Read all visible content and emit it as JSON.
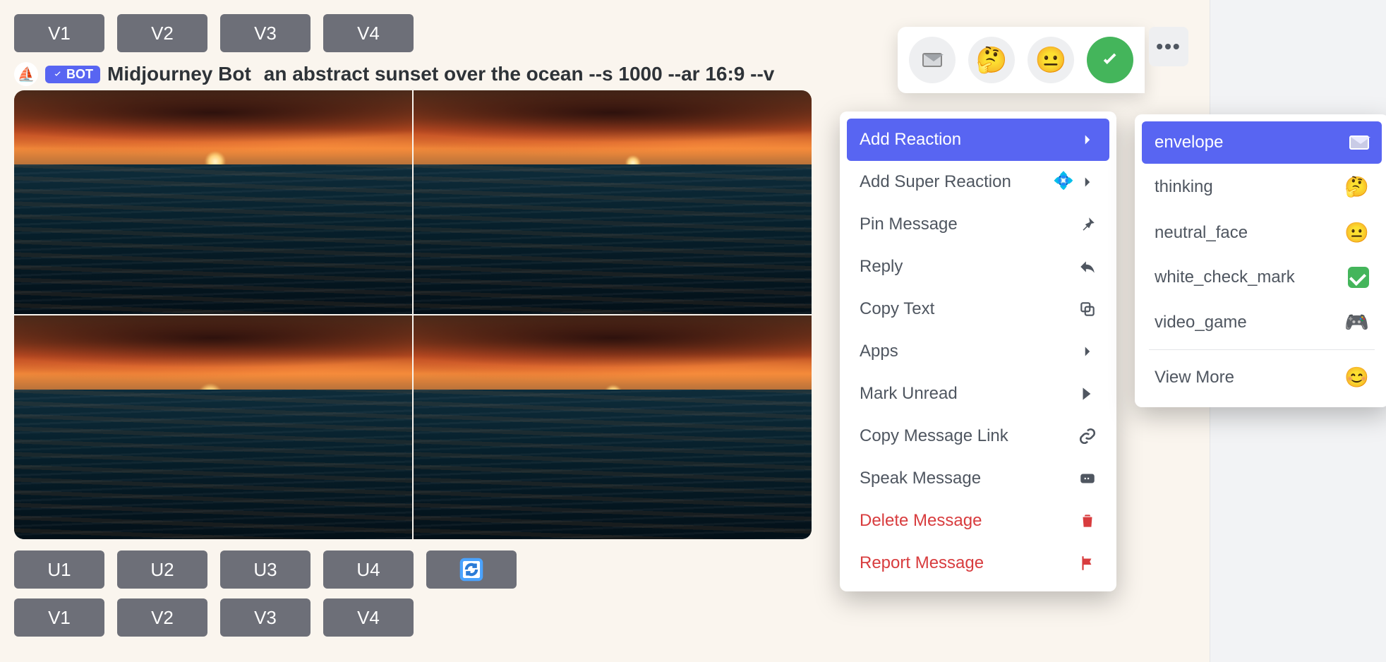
{
  "buttons_top": [
    "V1",
    "V2",
    "V3",
    "V4"
  ],
  "message": {
    "bot_tag": "BOT",
    "bot_name": "Midjourney Bot",
    "prompt": "an abstract sunset over the ocean --s 1000 --ar 16:9 --v"
  },
  "buttons_u": [
    "U1",
    "U2",
    "U3",
    "U4"
  ],
  "buttons_v_bottom": [
    "V1",
    "V2",
    "V3",
    "V4"
  ],
  "quick_reactions": [
    {
      "name": "envelope",
      "kind": "env"
    },
    {
      "name": "thinking",
      "emoji": "🤔"
    },
    {
      "name": "neutral_face",
      "emoji": "😐"
    },
    {
      "name": "white_check_mark",
      "kind": "check"
    }
  ],
  "context_menu": [
    {
      "label": "Add Reaction",
      "icon": "chevron",
      "highlight": true
    },
    {
      "label": "Add Super Reaction",
      "icon": "super"
    },
    {
      "label": "Pin Message",
      "icon": "pin"
    },
    {
      "label": "Reply",
      "icon": "reply"
    },
    {
      "label": "Copy Text",
      "icon": "copy"
    },
    {
      "label": "Apps",
      "icon": "chevron"
    },
    {
      "label": "Mark Unread",
      "icon": "unread"
    },
    {
      "label": "Copy Message Link",
      "icon": "link"
    },
    {
      "label": "Speak Message",
      "icon": "speak"
    },
    {
      "label": "Delete Message",
      "icon": "trash",
      "danger": true
    },
    {
      "label": "Report Message",
      "icon": "flag",
      "danger": true
    }
  ],
  "reaction_menu": [
    {
      "label": "envelope",
      "emoji_kind": "env",
      "highlight": true
    },
    {
      "label": "thinking",
      "emoji": "🤔"
    },
    {
      "label": "neutral_face",
      "emoji": "😐"
    },
    {
      "label": "white_check_mark",
      "emoji_kind": "check"
    },
    {
      "label": "video_game",
      "emoji": "🎮"
    }
  ],
  "reaction_view_more": "View More"
}
